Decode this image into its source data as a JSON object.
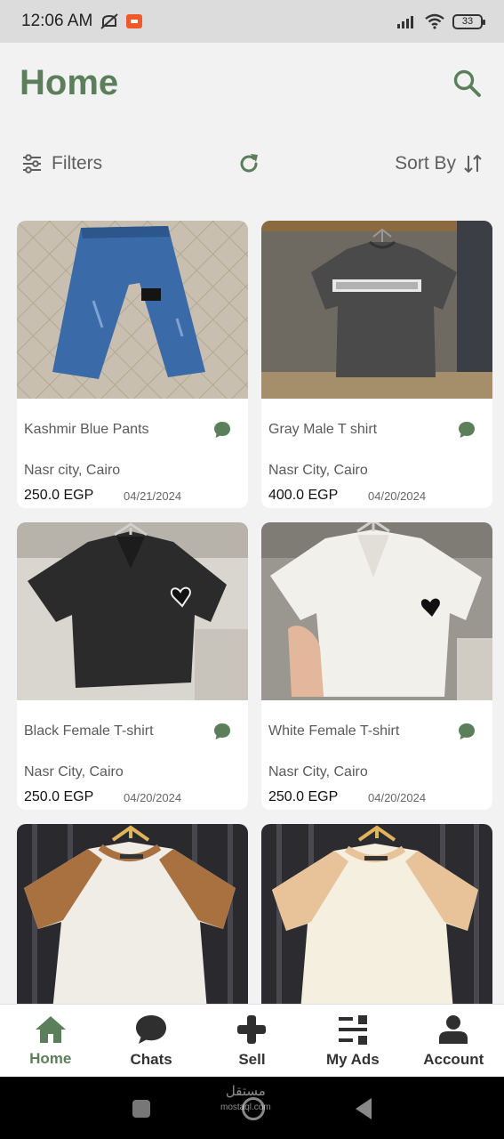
{
  "status_bar": {
    "time": "12:06 AM",
    "battery": "33"
  },
  "header": {
    "title": "Home"
  },
  "toolbar": {
    "filters_label": "Filters",
    "sort_label": "Sort By"
  },
  "products": [
    {
      "title": "Kashmir Blue Pants",
      "location": "Nasr city, Cairo",
      "price": "250.0 EGP",
      "date": "04/21/2024"
    },
    {
      "title": "Gray Male T shirt",
      "location": "Nasr City, Cairo",
      "price": "400.0 EGP",
      "date": "04/20/2024"
    },
    {
      "title": "Black Female T-shirt",
      "location": "Nasr City, Cairo",
      "price": "250.0 EGP",
      "date": "04/20/2024"
    },
    {
      "title": "White Female T-shirt",
      "location": "Nasr City, Cairo",
      "price": "250.0 EGP",
      "date": "04/20/2024"
    }
  ],
  "nav": {
    "items": [
      {
        "label": "Home",
        "icon": "home-icon"
      },
      {
        "label": "Chats",
        "icon": "chat-bubble-icon"
      },
      {
        "label": "Sell",
        "icon": "plus-icon"
      },
      {
        "label": "My Ads",
        "icon": "list-icon"
      },
      {
        "label": "Account",
        "icon": "person-icon"
      }
    ]
  },
  "watermark": {
    "text": "مستقل",
    "sub": "mostaql.com"
  },
  "colors": {
    "accent": "#5b7f5a",
    "nav_icon": "#2f2f2f"
  }
}
